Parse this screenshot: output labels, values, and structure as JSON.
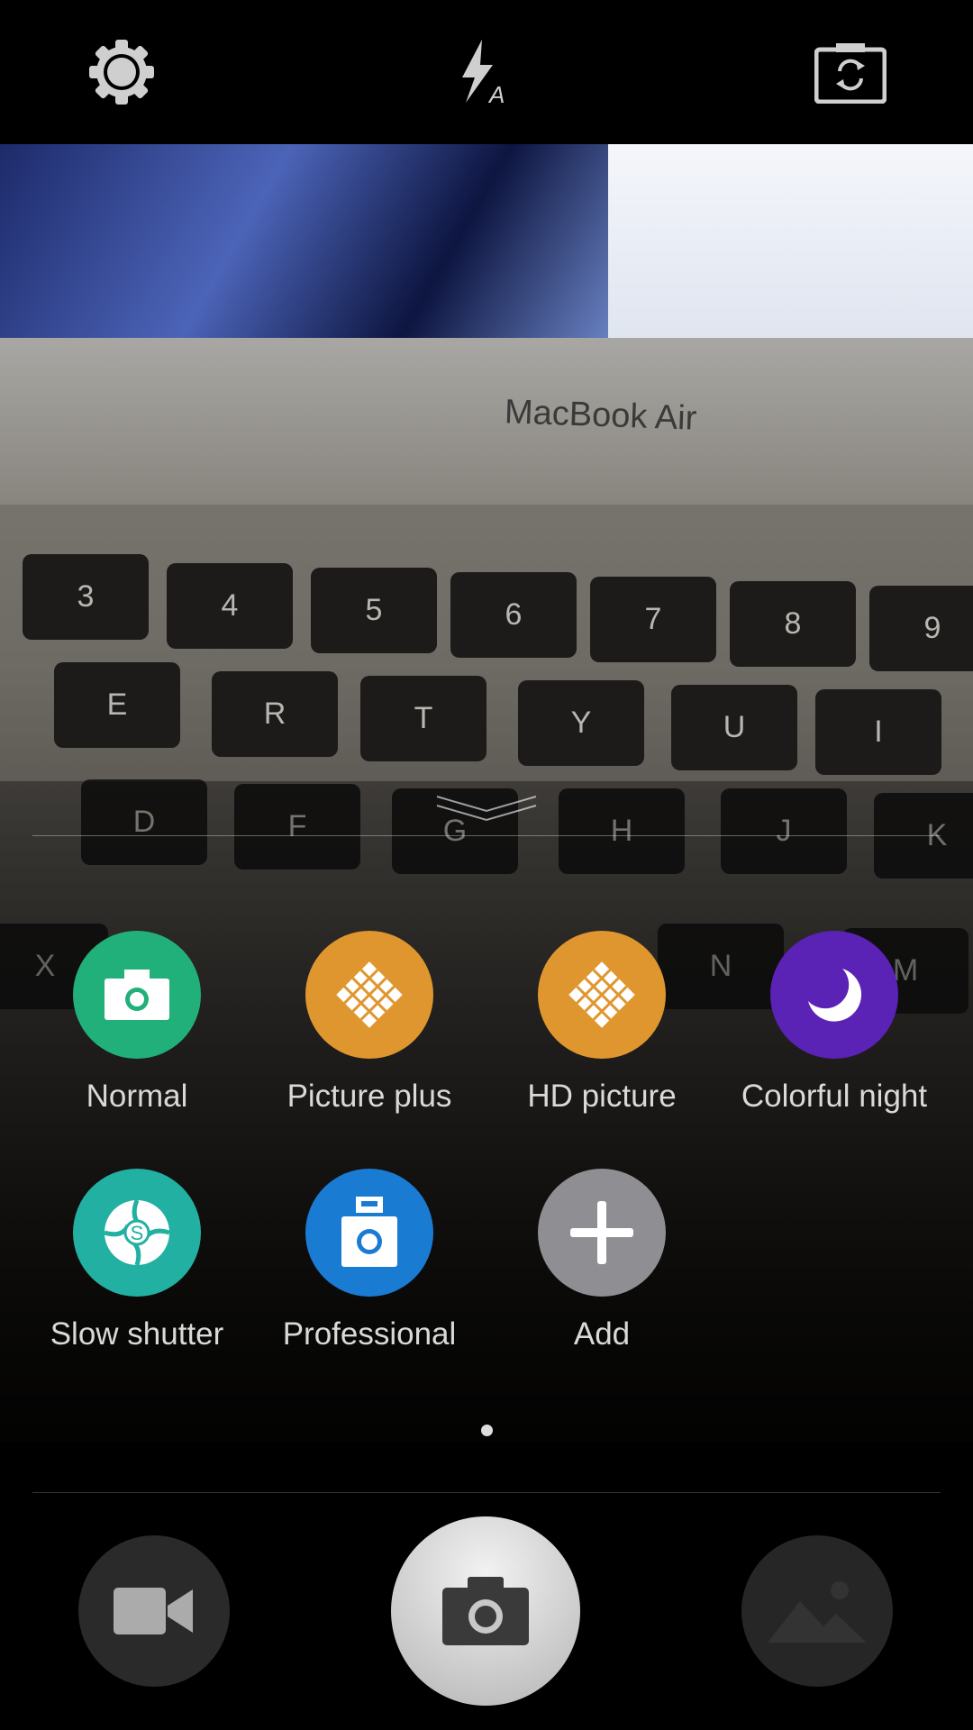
{
  "top_bar": {
    "icons": [
      "settings-gear-icon",
      "flash-auto-icon",
      "switch-camera-icon"
    ]
  },
  "preview": {
    "brand_text": "MacBook Air",
    "keys": [
      "3",
      "4",
      "5",
      "6",
      "7",
      "8",
      "9",
      "E",
      "R",
      "T",
      "Y",
      "U",
      "I",
      "D",
      "F",
      "G",
      "H",
      "J",
      "K",
      "X",
      "N",
      "M"
    ]
  },
  "modes": [
    {
      "label": "Normal",
      "color": "#22b07a",
      "icon": "camera-icon"
    },
    {
      "label": "Picture plus",
      "color": "#e0962e",
      "icon": "grid-diamond-icon"
    },
    {
      "label": "HD picture",
      "color": "#e0962e",
      "icon": "grid-diamond-icon"
    },
    {
      "label": "Colorful night",
      "color": "#5a22b5",
      "icon": "moon-icon"
    },
    {
      "label": "Slow shutter",
      "color": "#22b0a2",
      "icon": "shutter-s-icon"
    },
    {
      "label": "Professional",
      "color": "#1a7bd2",
      "icon": "pro-camera-icon"
    },
    {
      "label": "Add",
      "color": "#8e8e93",
      "icon": "plus-icon"
    }
  ],
  "pager": {
    "pages": 1,
    "current": 1
  },
  "bottom_bar": {
    "left": "video-icon",
    "center": "shutter-camera-icon",
    "right": "gallery-icon"
  }
}
